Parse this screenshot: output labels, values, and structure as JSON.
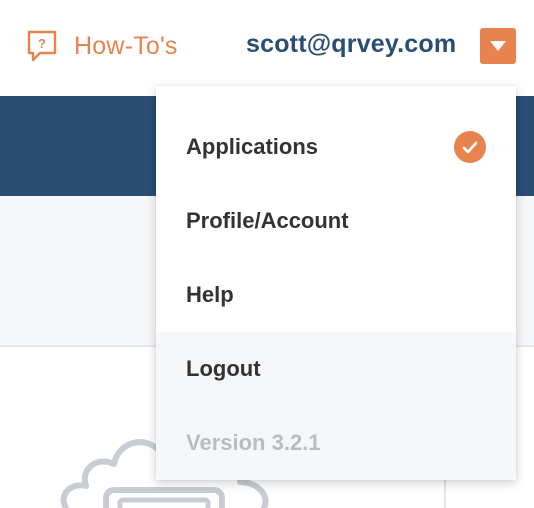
{
  "header": {
    "howto_label": "How-To's",
    "howto_icon": "question-speech-bubble-icon",
    "user_email": "scott@qrvey.com",
    "user_menu_toggle_icon": "caret-down-icon"
  },
  "user_menu": {
    "items": [
      {
        "label": "Applications",
        "selected": true
      },
      {
        "label": "Profile/Account",
        "selected": false
      },
      {
        "label": "Help",
        "selected": false
      },
      {
        "label": "Logout",
        "selected": false
      }
    ],
    "selected_icon": "check-circle-icon",
    "version": "Version 3.2.1"
  },
  "colors": {
    "accent": "#e8834d",
    "navy": "#2a4d73",
    "light_bg": "#f6f7f9",
    "muted_text": "#b9bcc0"
  }
}
